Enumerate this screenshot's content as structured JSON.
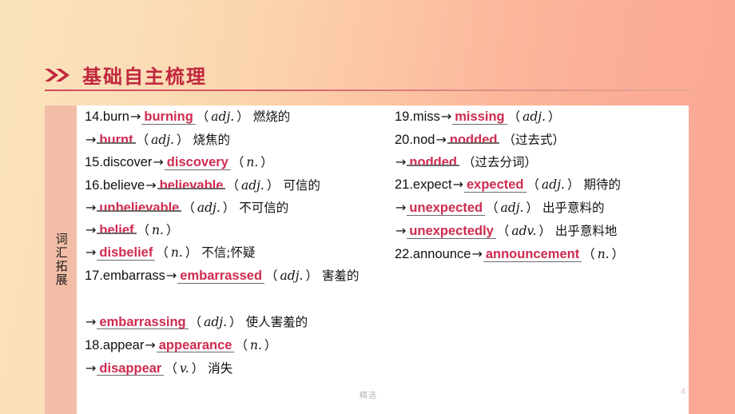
{
  "header": {
    "title": "基础自主梳理",
    "icon": "double-chevron-right-icon",
    "accent_color": "#c0273f"
  },
  "panel": {
    "gutter_label": "词汇拓展",
    "answer_color": "#cf2b50",
    "gutter_color": "#f2bda6"
  },
  "columns": {
    "left": [
      {
        "num": "14.",
        "stem": "burn",
        "arrow": "→",
        "answer": "burning",
        "rule": "low",
        "pos": "adj.",
        "cn": "燃烧的"
      },
      {
        "num": "",
        "stem": "",
        "arrow": "→",
        "answer": "burnt",
        "rule": "high",
        "pos": "adj.",
        "cn": "烧焦的"
      },
      {
        "num": "15.",
        "stem": "discover",
        "arrow": "→",
        "answer": "discovery",
        "rule": "low",
        "pos": "n.",
        "cn": ""
      },
      {
        "num": "16.",
        "stem": "believe",
        "arrow": "→",
        "answer": "believable",
        "rule": "high",
        "pos": "adj.",
        "cn": "可信的"
      },
      {
        "num": "",
        "stem": "",
        "arrow": "→",
        "answer": "unbelievable",
        "rule": "high",
        "pos": "adj.",
        "cn": "不可信的"
      },
      {
        "num": "",
        "stem": "",
        "arrow": "→",
        "answer": "belief",
        "rule": "high",
        "pos": "n.",
        "cn": ""
      },
      {
        "num": "",
        "stem": "",
        "arrow": "→",
        "answer": "disbelief",
        "rule": "low",
        "pos": "n.",
        "cn": "不信;怀疑"
      },
      {
        "num": "17.",
        "stem": "embarrass",
        "arrow": "→",
        "answer": "embarrassed",
        "rule": "low",
        "pos": "adj.",
        "cn": "害羞的"
      },
      {
        "num": "",
        "stem": "",
        "arrow": "→",
        "answer": "embarrassing",
        "rule": "low",
        "pos": "adj.",
        "cn": "使人害羞的"
      },
      {
        "num": "18.",
        "stem": "appear",
        "arrow": "→",
        "answer": "appearance",
        "rule": "low",
        "pos": "n.",
        "cn": ""
      },
      {
        "num": "",
        "stem": "",
        "arrow": "→",
        "answer": "disappear",
        "rule": "low",
        "pos": "v.",
        "cn": "消失"
      }
    ],
    "right": [
      {
        "num": "19.",
        "stem": "miss ",
        "arrow": "→",
        "answer": "missing",
        "rule": "low",
        "pos": "adj.",
        "cn": ""
      },
      {
        "num": "20.",
        "stem": "nod ",
        "arrow": "→",
        "answer": "nodded",
        "rule": "high",
        "pos": "",
        "cn": "（过去式）"
      },
      {
        "num": "",
        "stem": "",
        "arrow": "→",
        "answer": "nodded",
        "rule": "high",
        "pos": "",
        "cn": "（过去分词）"
      },
      {
        "num": "21.",
        "stem": "expect",
        "arrow": "→",
        "answer": "expected",
        "rule": "low",
        "pos": "adj.",
        "cn": "期待的"
      },
      {
        "num": "",
        "stem": "",
        "arrow": "→",
        "answer": "unexpected",
        "rule": "low",
        "pos": "adj.",
        "cn": "出乎意料的"
      },
      {
        "num": "",
        "stem": "",
        "arrow": "→",
        "answer": "unexpectedly",
        "rule": "low",
        "pos": "adv.",
        "cn": "出乎意料地"
      },
      {
        "num": "22.",
        "stem": "announce",
        "arrow": "→",
        "answer": "announcement",
        "rule": "low",
        "pos": "n.",
        "cn": ""
      }
    ]
  },
  "footer": {
    "watermark": "精选",
    "page_number": "4"
  }
}
